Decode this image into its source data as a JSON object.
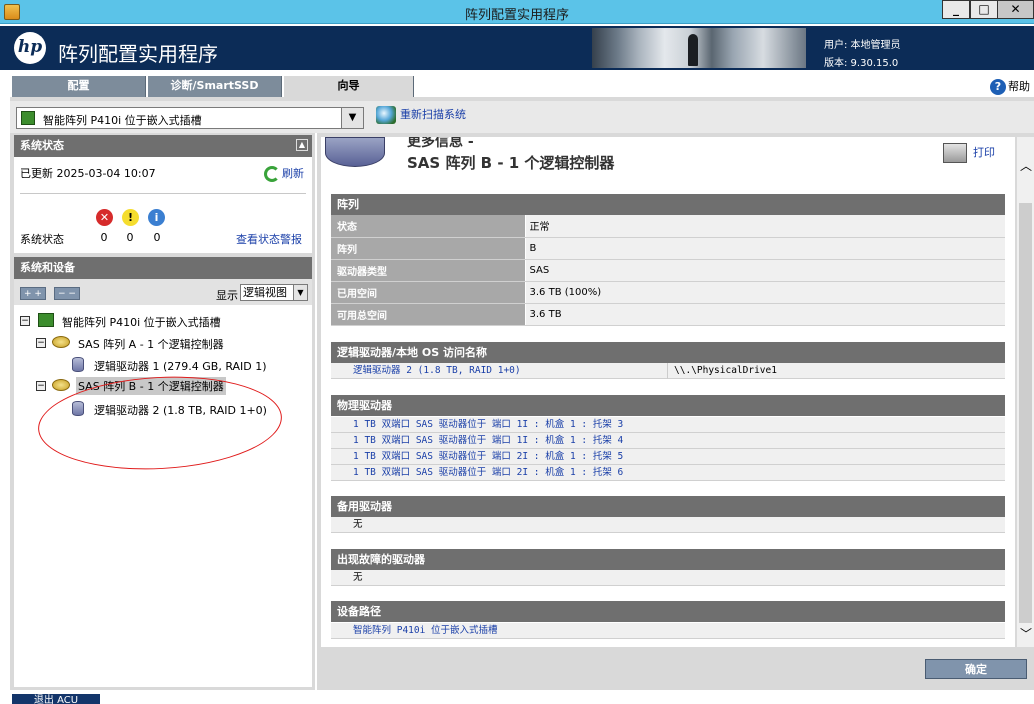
{
  "window": {
    "title": "阵列配置实用程序",
    "min": "_",
    "max": "□",
    "close": "✕"
  },
  "header": {
    "logo": "hp",
    "app_title": "阵列配置实用程序",
    "user": "用户: 本地管理员",
    "version": "版本: 9.30.15.0"
  },
  "tabs": [
    {
      "label": "配置"
    },
    {
      "label": "诊断/SmartSSD"
    },
    {
      "label": "向导"
    }
  ],
  "help": "帮助",
  "controller": {
    "selected": "智能阵列 P410i 位于嵌入式插槽",
    "rescan": "重新扫描系统"
  },
  "status": {
    "title": "系统状态",
    "updated": "已更新 2025-03-04 10:07",
    "refresh": "刷新",
    "label": "系统状态",
    "errors": "0",
    "warnings": "0",
    "info": "0",
    "view_alerts": "查看状态警报"
  },
  "devices": {
    "title": "系统和设备",
    "expand": "+ +",
    "collapse": "− −",
    "show_label": "显示",
    "view": "逻辑视图",
    "tree": {
      "controller": "智能阵列 P410i 位于嵌入式插槽",
      "array_a": "SAS 阵列 A - 1 个逻辑控制器",
      "ld1": "逻辑驱动器 1 (279.4 GB, RAID 1)",
      "array_b": "SAS 阵列 B - 1 个逻辑控制器",
      "ld2": "逻辑驱动器 2 (1.8 TB, RAID 1+0)"
    }
  },
  "detail": {
    "more_info": "更多信息 -",
    "title": "SAS 阵列 B - 1 个逻辑控制器",
    "print": "打印",
    "array_section": "阵列",
    "array_rows": [
      {
        "k": "状态",
        "v": "正常"
      },
      {
        "k": "阵列",
        "v": "B"
      },
      {
        "k": "驱动器类型",
        "v": "SAS"
      },
      {
        "k": "已用空间",
        "v": "3.6 TB (100%)"
      },
      {
        "k": "可用总空间",
        "v": "3.6 TB"
      }
    ],
    "ld_section": "逻辑驱动器/本地 OS 访问名称",
    "ld_name": "逻辑驱动器 2 (1.8 TB, RAID 1+0)",
    "ld_os": "\\\\.\\PhysicalDrive1",
    "pd_section": "物理驱动器",
    "pd_rows": [
      "1 TB 双端口 SAS 驱动器位于 端口 1I : 机盒 1 : 托架 3",
      "1 TB 双端口 SAS 驱动器位于 端口 1I : 机盒 1 : 托架 4",
      "1 TB 双端口 SAS 驱动器位于 端口 2I : 机盒 1 : 托架 5",
      "1 TB 双端口 SAS 驱动器位于 端口 2I : 机盒 1 : 托架 6"
    ],
    "spare_section": "备用驱动器",
    "spare_value": "无",
    "failed_section": "出现故障的驱动器",
    "failed_value": "无",
    "path_section": "设备路径",
    "path_value": "智能阵列 P410i 位于嵌入式插槽"
  },
  "ok": "确定",
  "exit": "退出 ACU"
}
